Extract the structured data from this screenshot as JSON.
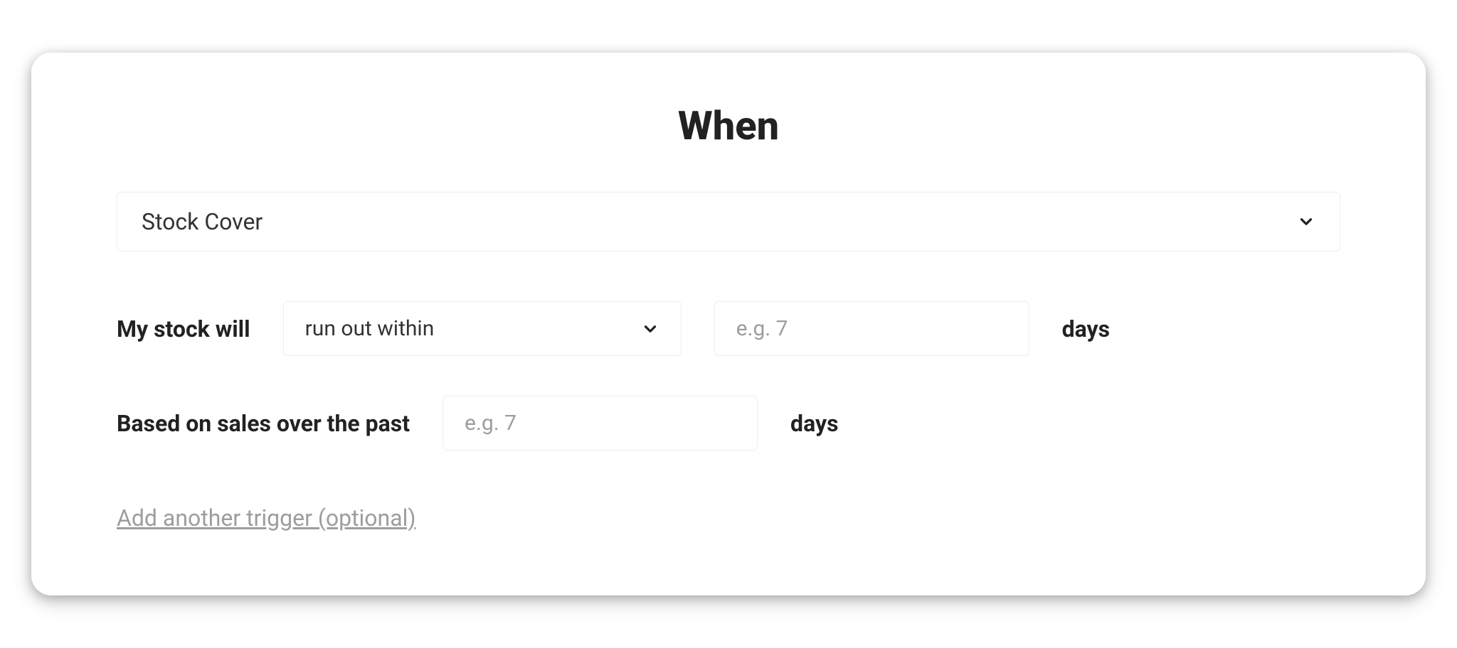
{
  "title": "When",
  "trigger_type": {
    "selected": "Stock Cover"
  },
  "row1": {
    "prefix": "My stock will",
    "condition_selected": "run out within",
    "days_placeholder": "e.g. 7",
    "unit": "days"
  },
  "row2": {
    "prefix": "Based on sales over the past",
    "days_placeholder": "e.g. 7",
    "unit": "days"
  },
  "add_link": "Add another trigger (optional)"
}
